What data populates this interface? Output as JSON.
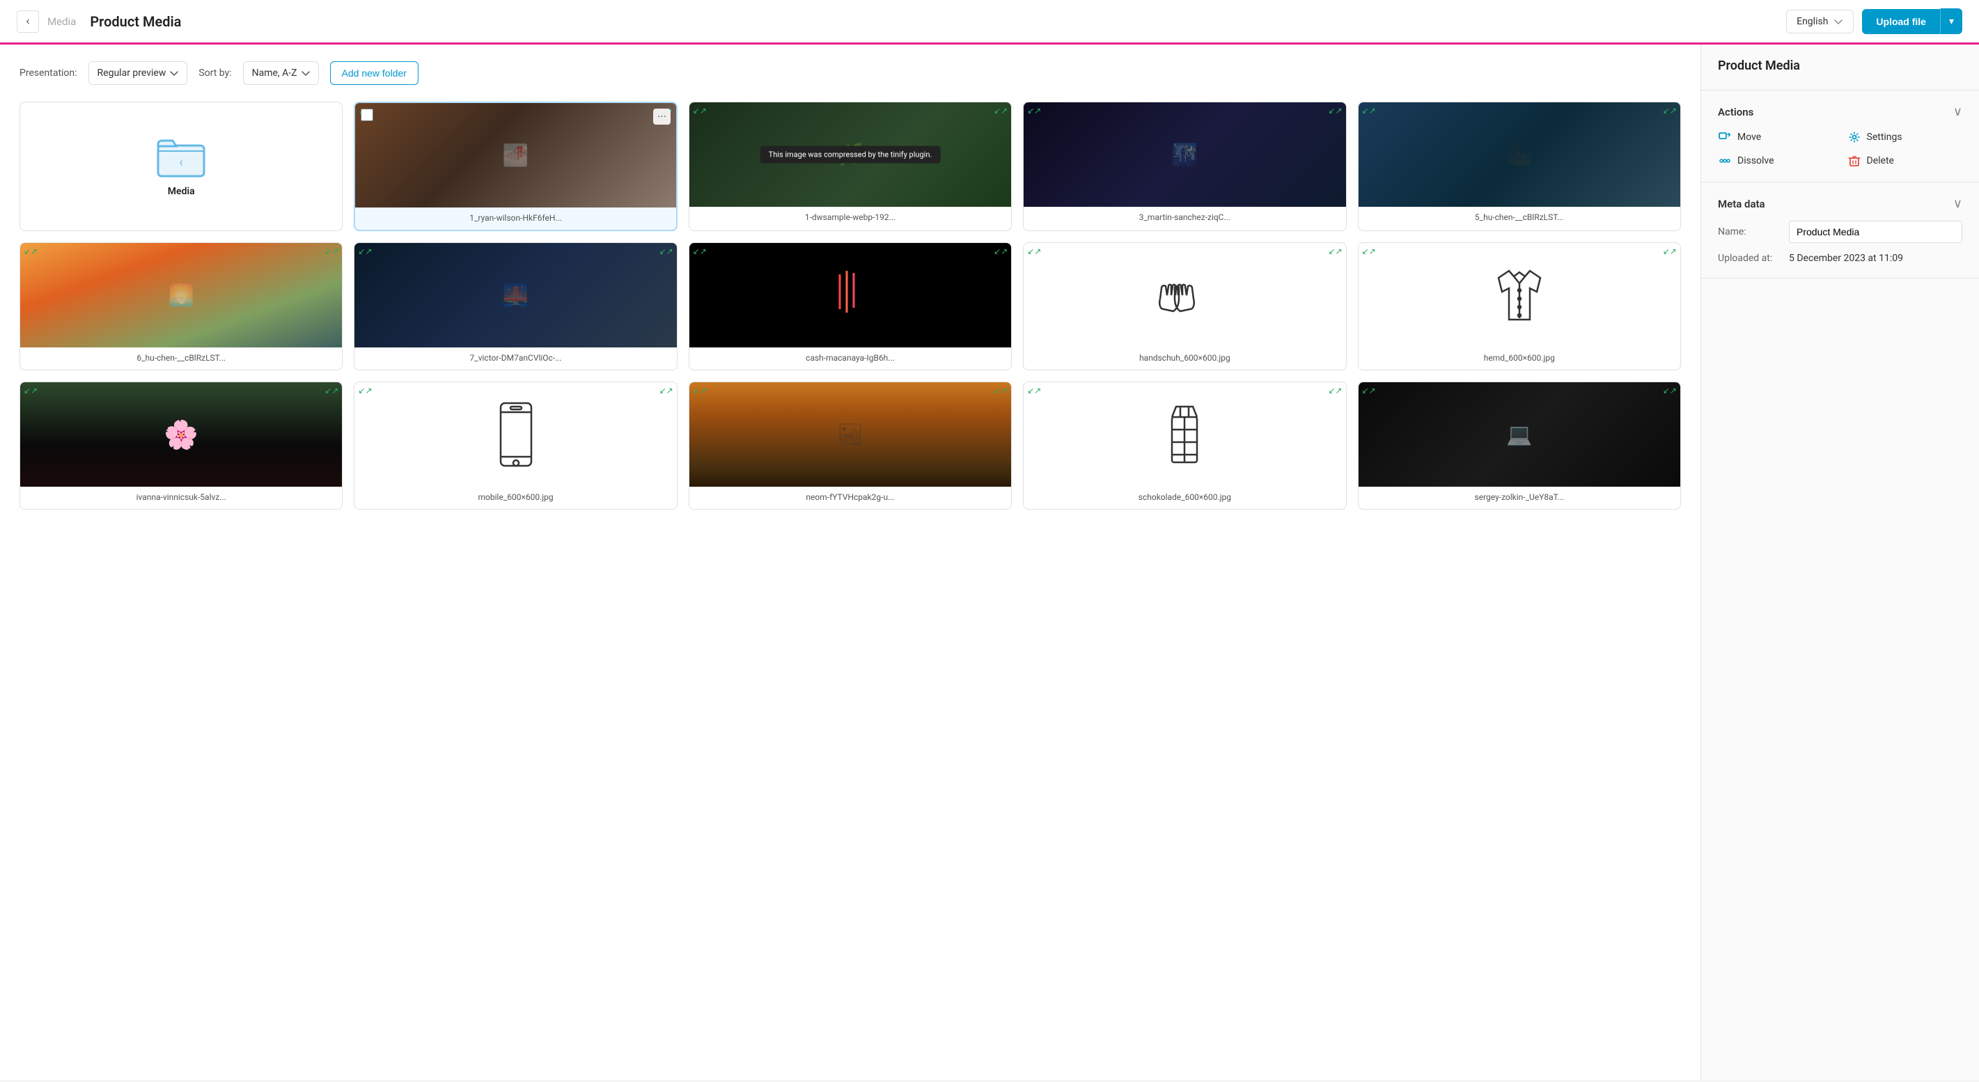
{
  "header": {
    "back_label": "‹",
    "breadcrumb": "Media",
    "title": "Product Media",
    "lang_label": "English",
    "upload_label": "Upload file"
  },
  "toolbar": {
    "presentation_label": "Presentation:",
    "presentation_value": "Regular preview",
    "sort_label": "Sort by:",
    "sort_value": "Name, A-Z",
    "add_folder_label": "Add new folder"
  },
  "media_items": [
    {
      "id": "folder",
      "type": "folder",
      "name": "Media",
      "selected": false
    },
    {
      "id": "img1",
      "type": "image",
      "name": "1_ryan-wilson-HkF6feH...",
      "selected": true,
      "bg": "#4a3728",
      "has_checkbox": true,
      "has_menu": true
    },
    {
      "id": "img2",
      "type": "image",
      "name": "1-dwsample-webp-192...",
      "selected": false,
      "bg": "#2d3a2e",
      "tooltip": "This image was compressed by the tinify plugin."
    },
    {
      "id": "img3",
      "type": "image",
      "name": "3_martin-sanchez-ziqC...",
      "selected": false,
      "bg": "#1a1a2e"
    },
    {
      "id": "img4",
      "type": "image",
      "name": "5_hu-chen-__cBlRzLST...",
      "selected": false,
      "bg": "#1a3a4a"
    },
    {
      "id": "img5",
      "type": "image",
      "name": "6_hu-chen-__cBlRzLST...",
      "selected": false,
      "bg": "#3a4a3a"
    },
    {
      "id": "img6",
      "type": "image",
      "name": "7_victor-DM7anCVliOc-...",
      "selected": false,
      "bg": "#1a2a3a"
    },
    {
      "id": "img7",
      "type": "image",
      "name": "cash-macanaya-IgB6h...",
      "selected": false,
      "bg": "#000000"
    },
    {
      "id": "img8",
      "type": "svg",
      "name": "handschuh_600×600.jpg",
      "selected": false,
      "bg": "#ffffff",
      "svg_type": "gloves"
    },
    {
      "id": "img9",
      "type": "svg",
      "name": "hemd_600×600.jpg",
      "selected": false,
      "bg": "#ffffff",
      "svg_type": "shirt"
    },
    {
      "id": "img10",
      "type": "image",
      "name": "ivanna-vinnicsuk-5alvz...",
      "selected": false,
      "bg": "#1a1a1a"
    },
    {
      "id": "img11",
      "type": "svg",
      "name": "mobile_600×600.jpg",
      "selected": false,
      "bg": "#ffffff",
      "svg_type": "phone"
    },
    {
      "id": "img12",
      "type": "image",
      "name": "neom-fYTVHcpak2g-u...",
      "selected": false,
      "bg": "#4a3a1a"
    },
    {
      "id": "img13",
      "type": "svg",
      "name": "schokolade_600×600.jpg",
      "selected": false,
      "bg": "#ffffff",
      "svg_type": "chocolate"
    },
    {
      "id": "img14",
      "type": "image",
      "name": "sergey-zolkin-_UeY8aT...",
      "selected": false,
      "bg": "#111111"
    }
  ],
  "right_panel": {
    "title": "Product Media",
    "actions_label": "Actions",
    "actions": [
      {
        "id": "move",
        "label": "Move",
        "icon": "move"
      },
      {
        "id": "settings",
        "label": "Settings",
        "icon": "settings"
      },
      {
        "id": "dissolve",
        "label": "Dissolve",
        "icon": "dissolve"
      },
      {
        "id": "delete",
        "label": "Delete",
        "icon": "delete"
      }
    ],
    "meta_label": "Meta data",
    "name_label": "Name:",
    "name_value": "Product Media",
    "uploaded_label": "Uploaded at:",
    "uploaded_value": "5 December 2023 at 11:09"
  }
}
